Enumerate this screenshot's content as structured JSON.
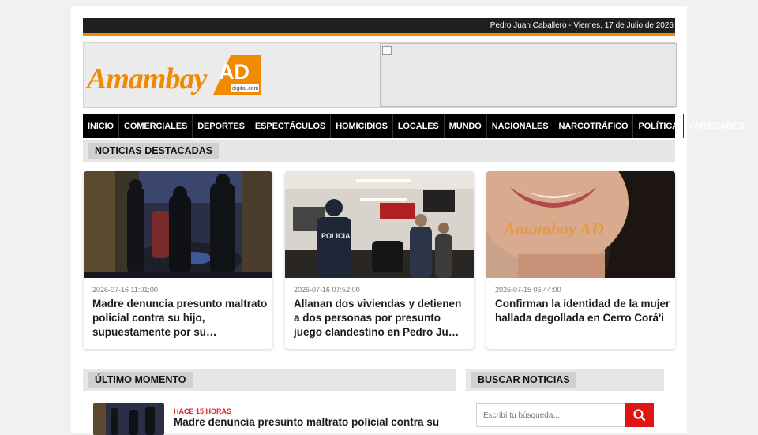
{
  "topbar": {
    "location_date": "Pedro Juan Caballero - Viernes, 17 de Julio de 2026"
  },
  "brand": {
    "logo_word": "Amambay",
    "logo_mark": "AD",
    "logo_sub": "digital.com",
    "color_orange": "#f08a00"
  },
  "nav": {
    "items": [
      "INICIO",
      "COMERCIALES",
      "DEPORTES",
      "ESPECTÁCULOS",
      "HOMICIDIOS",
      "LOCALES",
      "MUNDO",
      "NACIONALES",
      "NARCOTRÁFICO",
      "POLÍTICA",
      "VARIEDADES"
    ]
  },
  "featured": {
    "heading": "NOTICIAS DESTACADAS",
    "cards": [
      {
        "date": "2026-07-16 11:01:00",
        "title": "Madre denuncia presunto maltrato policial contra su hijo, supuestamente por su…"
      },
      {
        "date": "2026-07-16 07:52:00",
        "title": "Allanan dos viviendas y detienen a dos personas por presunto juego clandestino en Pedro Ju…"
      },
      {
        "date": "2026-07-15 06:44:00",
        "title": "Confirman la identidad de la mujer hallada degollada en Cerro Corá'i"
      }
    ]
  },
  "latest": {
    "heading": "ÚLTIMO MOMENTO",
    "items": [
      {
        "time": "HACE 15 HORAS",
        "title": "Madre denuncia presunto maltrato policial contra su"
      }
    ]
  },
  "search": {
    "heading": "BUSCAR NOTICIAS",
    "placeholder": "Escribí tu búsqueda..."
  },
  "photo_labels": {
    "police_vest": "POLICIA"
  },
  "watermark": "Amambay AD"
}
